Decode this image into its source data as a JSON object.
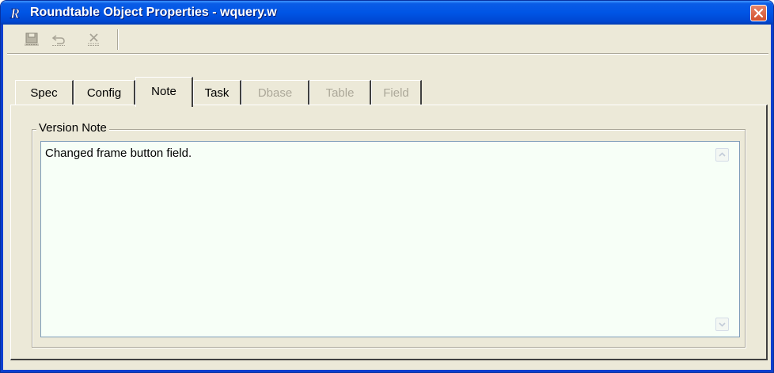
{
  "window": {
    "title": "Roundtable Object Properties - wquery.w",
    "app_icon": "roundtable-r-icon",
    "close_icon": "close-icon",
    "colors": {
      "titlebar": "#0055e5",
      "close": "#d4502c",
      "face": "#ece9d8",
      "note_bg": "#f7fff7"
    }
  },
  "toolbar": {
    "buttons": [
      {
        "icon": "save-icon",
        "enabled": false
      },
      {
        "icon": "undo-icon",
        "enabled": false
      },
      {
        "icon": "delete-icon",
        "enabled": false
      }
    ]
  },
  "tabs": [
    {
      "label": "Spec",
      "state": "inactive"
    },
    {
      "label": "Config",
      "state": "inactive"
    },
    {
      "label": "Note",
      "state": "active"
    },
    {
      "label": "Task",
      "state": "inactive"
    },
    {
      "label": "Dbase",
      "state": "disabled"
    },
    {
      "label": "Table",
      "state": "disabled"
    },
    {
      "label": "Field",
      "state": "disabled"
    }
  ],
  "note": {
    "group_label": "Version Note",
    "text": "Changed frame button field.",
    "scroll_up_icon": "scroll-up-arrow-icon",
    "scroll_down_icon": "scroll-down-arrow-icon"
  }
}
